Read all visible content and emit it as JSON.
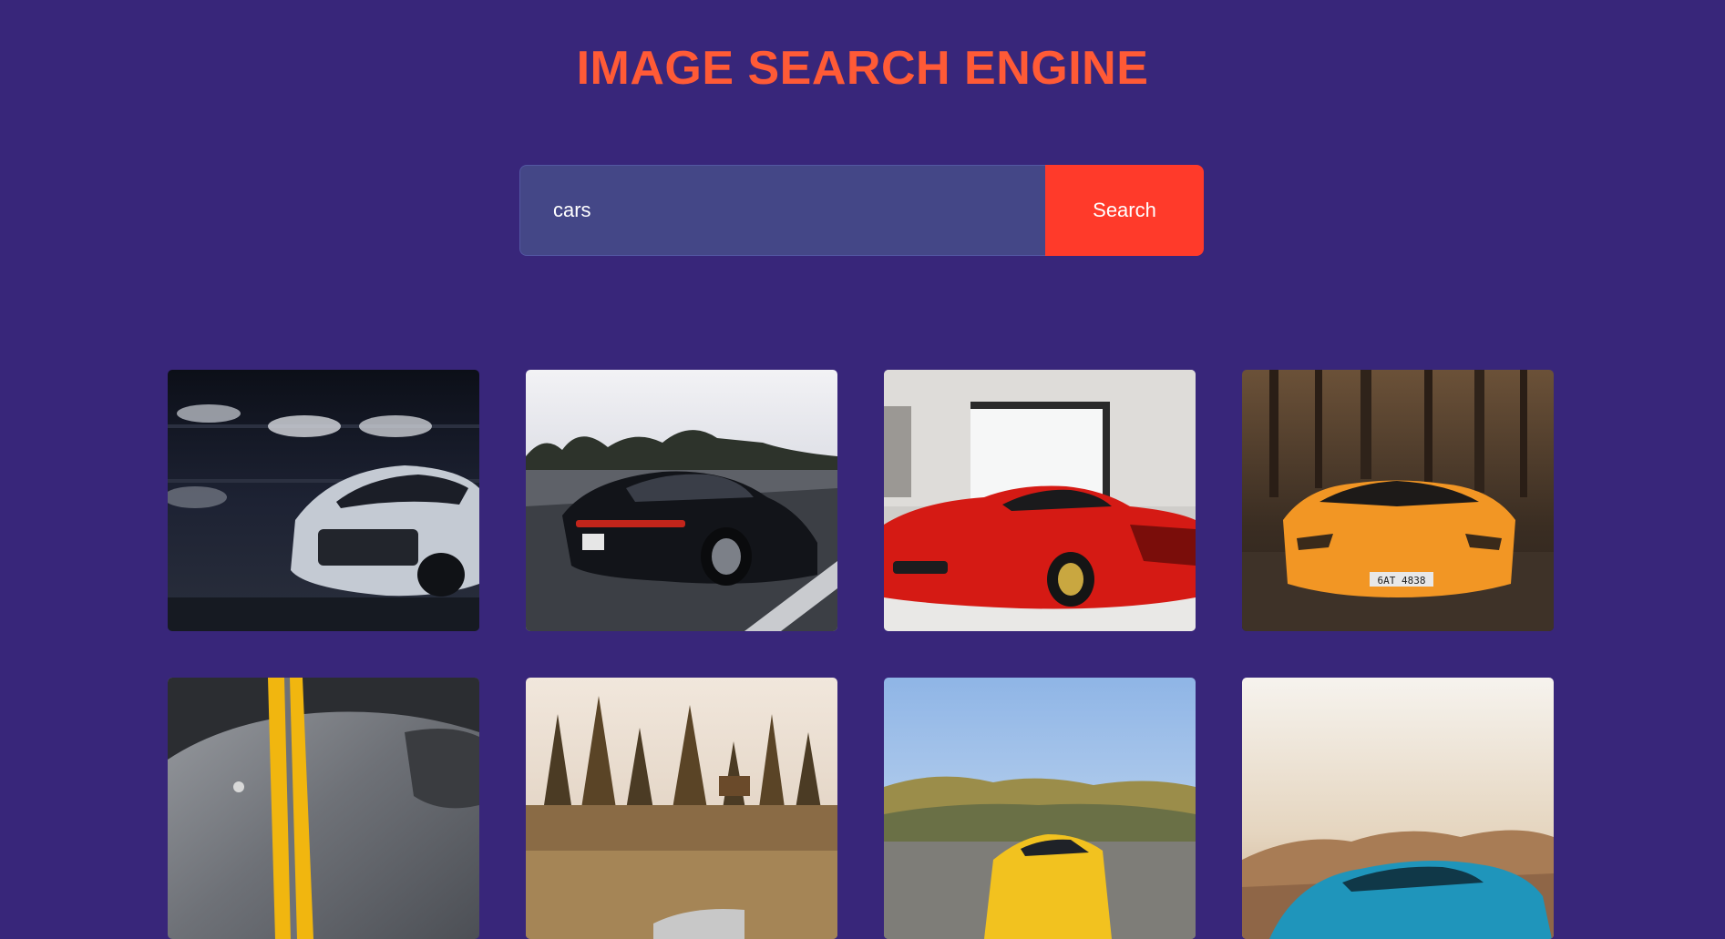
{
  "header": {
    "title": "IMAGE SEARCH ENGINE"
  },
  "search": {
    "value": "cars",
    "button_label": "Search"
  },
  "results": [
    {
      "name": "white-camaro-garage",
      "scene": "dark-garage",
      "car_color": "#b8c0cc"
    },
    {
      "name": "black-porsche-panamera",
      "scene": "highway",
      "car_color": "#111318"
    },
    {
      "name": "red-ferrari-laferrari",
      "scene": "showroom",
      "car_color": "#d81c16"
    },
    {
      "name": "orange-lamborghini-forest",
      "scene": "forest",
      "car_color": "#f39a2a"
    },
    {
      "name": "grey-car-yellow-stripe",
      "scene": "closeup",
      "car_color": "#7c7f85"
    },
    {
      "name": "car-pine-trees",
      "scene": "trees",
      "car_color": "#c8c8c8"
    },
    {
      "name": "yellow-sports-car",
      "scene": "sky",
      "car_color": "#f0c020"
    },
    {
      "name": "blue-camaro-desert",
      "scene": "desert",
      "car_color": "#1f93b8"
    }
  ]
}
